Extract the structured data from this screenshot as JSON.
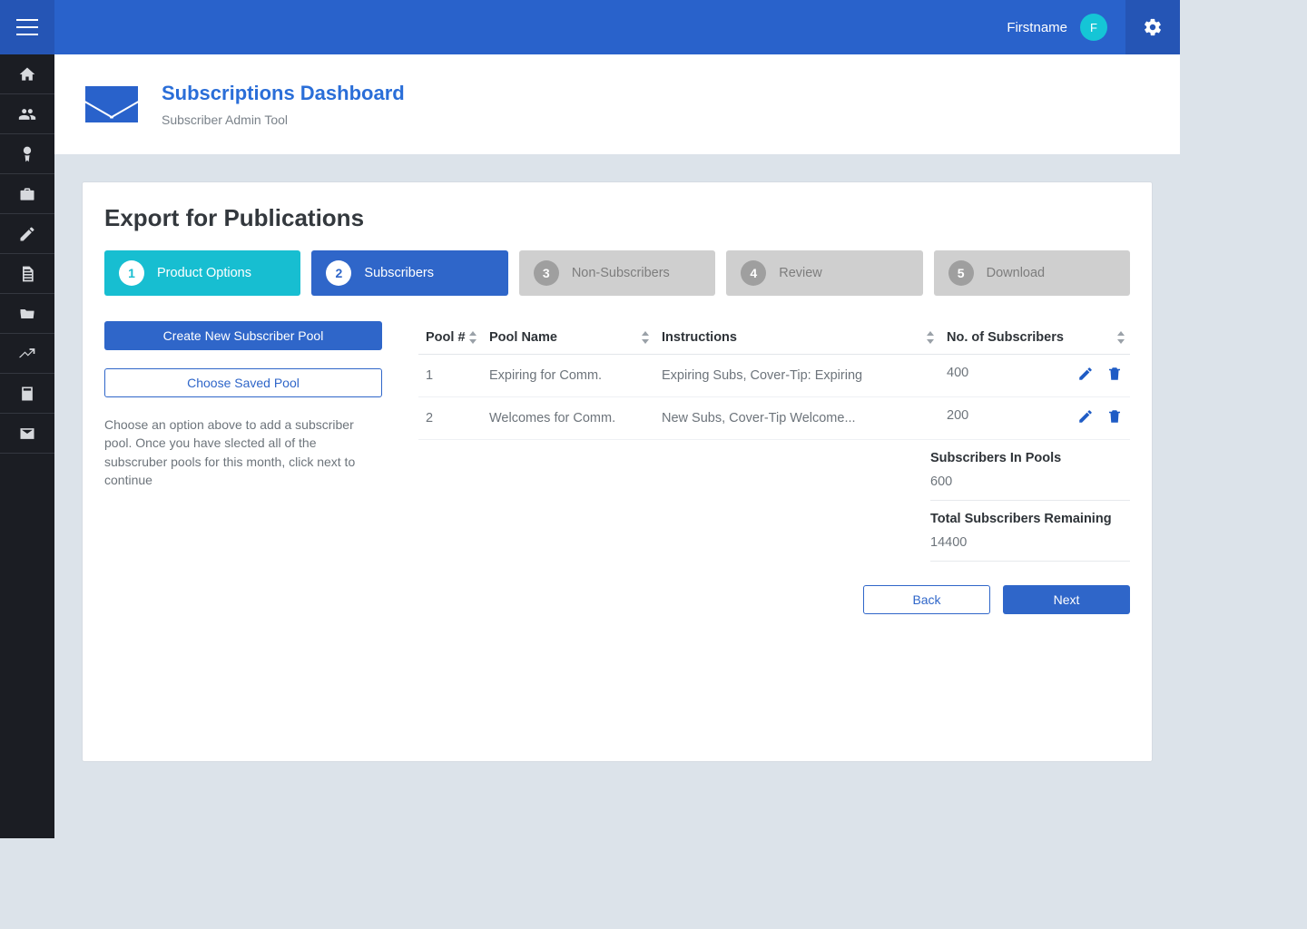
{
  "topbar": {
    "username": "Firstname",
    "avatar_letter": "F"
  },
  "header": {
    "title": "Subscriptions Dashboard",
    "subtitle": "Subscriber Admin Tool"
  },
  "page_title": "Export for Publications",
  "stepper": [
    {
      "num": "1",
      "label": "Product Options",
      "state": "prev"
    },
    {
      "num": "2",
      "label": "Subscribers",
      "state": "active"
    },
    {
      "num": "3",
      "label": "Non-Subscribers",
      "state": "next"
    },
    {
      "num": "4",
      "label": "Review",
      "state": "next"
    },
    {
      "num": "5",
      "label": "Download",
      "state": "next"
    }
  ],
  "left_pane": {
    "create_btn": "Create New Subscriber Pool",
    "choose_btn": "Choose Saved Pool",
    "help": "Choose an option above to add a subscriber pool. Once you have slected all of the subscruber pools for this month, click next to continue"
  },
  "table": {
    "headers": {
      "pool_no": "Pool #",
      "pool_name": "Pool Name",
      "instructions": "Instructions",
      "subs": "No. of Subscribers"
    },
    "rows": [
      {
        "no": "1",
        "name": "Expiring for Comm.",
        "instr": "Expiring Subs, Cover-Tip: Expiring",
        "subs": "400"
      },
      {
        "no": "2",
        "name": "Welcomes for Comm.",
        "instr": "New Subs, Cover-Tip Welcome...",
        "subs": "200"
      }
    ]
  },
  "summary": {
    "in_pools_label": "Subscribers In Pools",
    "in_pools_value": "600",
    "remaining_label": "Total Subscribers Remaining",
    "remaining_value": "14400"
  },
  "footer": {
    "back": "Back",
    "next": "Next"
  }
}
